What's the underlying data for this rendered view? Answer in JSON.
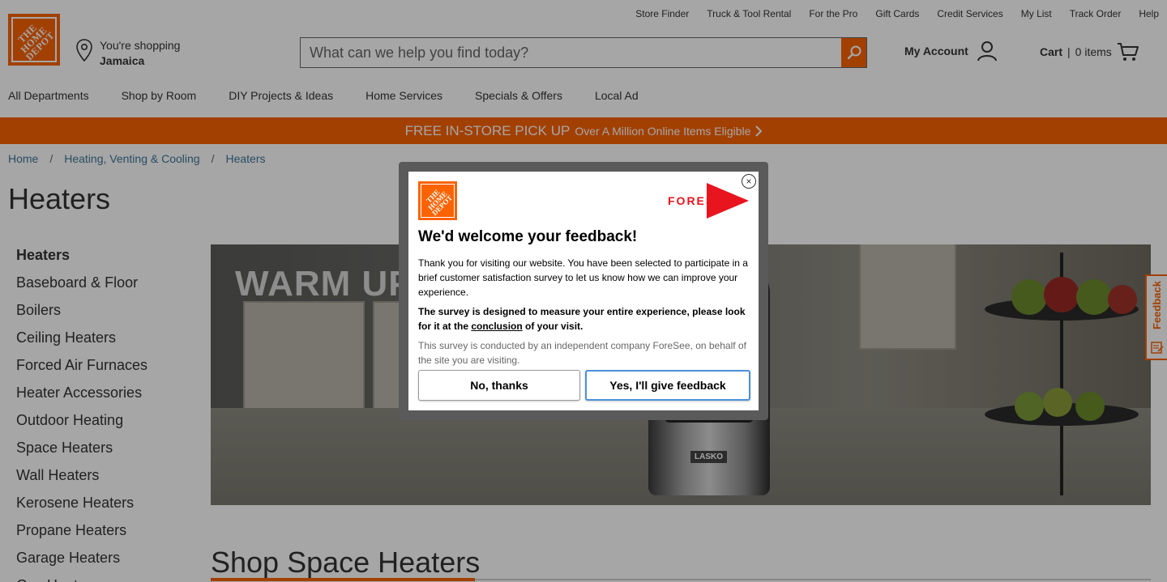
{
  "colors": {
    "brand_orange": "#f96302",
    "link_blue": "#3e7697",
    "overlay": "rgba(0,0,0,0.35)"
  },
  "header": {
    "utility_links": [
      "Store Finder",
      "Truck & Tool Rental",
      "For the Pro",
      "Gift Cards",
      "Credit Services",
      "My List",
      "Track Order",
      "Help"
    ],
    "logo_text": "THE HOME DEPOT",
    "location": {
      "label": "You're shopping",
      "store": "Jamaica",
      "icon": "map-pin-icon"
    },
    "search": {
      "placeholder": "What can we help you find today?",
      "button_icon": "search-icon"
    },
    "account": {
      "label": "My Account",
      "icon": "user-icon"
    },
    "cart": {
      "label": "Cart",
      "separator": "|",
      "count": "0 items",
      "icon": "cart-icon"
    }
  },
  "nav": [
    "All Departments",
    "Shop by Room",
    "DIY Projects & Ideas",
    "Home Services",
    "Specials & Offers",
    "Local Ad"
  ],
  "promo": {
    "main": "FREE IN-STORE PICK UP",
    "sub": "Over A Million Online Items Eligible",
    "icon": "chevron-right-icon"
  },
  "breadcrumb": [
    "Home",
    "Heating, Venting & Cooling",
    "Heaters"
  ],
  "page_title": "Heaters",
  "sidenav": [
    "Heaters",
    "Baseboard & Floor",
    "Boilers",
    "Ceiling Heaters",
    "Forced Air Furnaces",
    "Heater Accessories",
    "Outdoor Heating",
    "Space Heaters",
    "Wall Heaters",
    "Kerosene Heaters",
    "Propane Heaters",
    "Garage Heaters",
    "Gas Heaters"
  ],
  "hero": {
    "text": "WARM UP W",
    "badge": "LASKO"
  },
  "section_title": "Shop Space Heaters",
  "feedback_tab": {
    "label": "Feedback",
    "icon": "feedback-icon"
  },
  "modal": {
    "logo_text": "THE HOME DEPOT",
    "vendor_logo_text": "FORESEE",
    "title": "We'd welcome your feedback!",
    "p1": "Thank you for visiting our website. You have been selected to participate in a brief customer satisfaction survey to let us know how we can improve your experience.",
    "p2_before": "The survey is designed to measure your entire experience, please look for it at the ",
    "p2_link": "conclusion",
    "p2_after": " of your visit.",
    "p3": "This survey is conducted by an independent company ForeSee, on behalf of the site you are visiting.",
    "decline_label": "No, thanks",
    "accept_label": "Yes, I'll give feedback",
    "close_icon": "close-icon"
  }
}
